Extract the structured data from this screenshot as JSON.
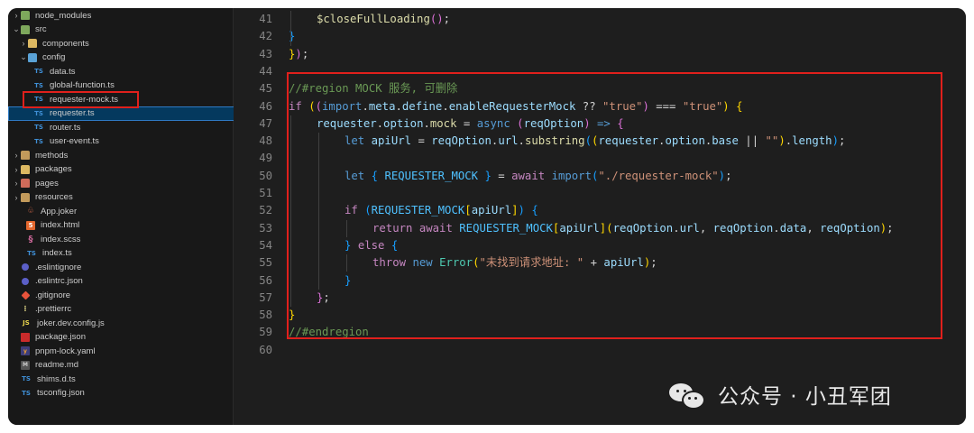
{
  "sidebar": {
    "items": [
      {
        "label": "node_modules",
        "kind": "folder-green",
        "chevron": "›"
      },
      {
        "label": "src",
        "kind": "folder-green",
        "chevron": "⌄"
      },
      {
        "label": "components",
        "kind": "folder",
        "chevron": "›"
      },
      {
        "label": "config",
        "kind": "folder-blue",
        "chevron": "⌄"
      },
      {
        "label": "data.ts",
        "kind": "ts",
        "icon": "TS"
      },
      {
        "label": "global-function.ts",
        "kind": "ts",
        "icon": "TS"
      },
      {
        "label": "requester-mock.ts",
        "kind": "ts",
        "icon": "TS"
      },
      {
        "label": "requester.ts",
        "kind": "ts",
        "icon": "TS"
      },
      {
        "label": "router.ts",
        "kind": "ts",
        "icon": "TS"
      },
      {
        "label": "user-event.ts",
        "kind": "ts",
        "icon": "TS"
      },
      {
        "label": "methods",
        "kind": "folder-brown",
        "chevron": "›"
      },
      {
        "label": "packages",
        "kind": "folder",
        "chevron": "›"
      },
      {
        "label": "pages",
        "kind": "folder-red",
        "chevron": "›"
      },
      {
        "label": "resources",
        "kind": "folder-brown",
        "chevron": "›"
      },
      {
        "label": "App.joker",
        "kind": "joker",
        "icon": "♧"
      },
      {
        "label": "index.html",
        "kind": "html",
        "icon": "5"
      },
      {
        "label": "index.scss",
        "kind": "scss",
        "icon": "§"
      },
      {
        "label": "index.ts",
        "kind": "ts",
        "icon": "TS"
      },
      {
        "label": ".eslintignore",
        "kind": "dot-blue",
        "icon": ""
      },
      {
        "label": ".eslintrc.json",
        "kind": "dot-blue",
        "icon": ""
      },
      {
        "label": ".gitignore",
        "kind": "git",
        "icon": ""
      },
      {
        "label": ".prettierrc",
        "kind": "prettier",
        "icon": "⁝"
      },
      {
        "label": "joker.dev.config.js",
        "kind": "js",
        "icon": "JS"
      },
      {
        "label": "package.json",
        "kind": "npm",
        "icon": ""
      },
      {
        "label": "pnpm-lock.yaml",
        "kind": "yaml",
        "icon": "y"
      },
      {
        "label": "readme.md",
        "kind": "md",
        "icon": "M"
      },
      {
        "label": "shims.d.ts",
        "kind": "ts",
        "icon": "TS"
      },
      {
        "label": "tsconfig.json",
        "kind": "ts",
        "icon": "TS"
      }
    ]
  },
  "editor": {
    "lines": [
      {
        "n": "41",
        "tokens": [
          [
            "c-fn",
            "$closeFullLoading"
          ],
          [
            "c-br2",
            "("
          ],
          [
            "c-br2",
            ")"
          ],
          [
            "c-pl",
            ";"
          ]
        ]
      },
      {
        "n": "42",
        "tokens": [
          [
            "c-br3",
            "}"
          ]
        ]
      },
      {
        "n": "43",
        "tokens": [
          [
            "c-br1",
            "}"
          ],
          [
            "c-br2",
            ")"
          ],
          [
            "c-pl",
            ";"
          ]
        ]
      },
      {
        "n": "44",
        "tokens": []
      },
      {
        "n": "45",
        "tokens": [
          [
            "c-cm",
            "//#region MOCK 服务, 可删除"
          ]
        ]
      },
      {
        "n": "46",
        "tokens": [
          [
            "c-ctl",
            "if"
          ],
          [
            "c-pl",
            " "
          ],
          [
            "c-br1",
            "("
          ],
          [
            "c-br2",
            "("
          ],
          [
            "c-kw",
            "import"
          ],
          [
            "c-pl",
            "."
          ],
          [
            "c-var",
            "meta"
          ],
          [
            "c-pl",
            "."
          ],
          [
            "c-var",
            "define"
          ],
          [
            "c-pl",
            "."
          ],
          [
            "c-var",
            "enableRequesterMock"
          ],
          [
            "c-pl",
            " ?? "
          ],
          [
            "c-str",
            "\"true\""
          ],
          [
            "c-br2",
            ")"
          ],
          [
            "c-pl",
            " === "
          ],
          [
            "c-str",
            "\"true\""
          ],
          [
            "c-br1",
            ")"
          ],
          [
            "c-pl",
            " "
          ],
          [
            "c-br1",
            "{"
          ]
        ]
      },
      {
        "n": "47",
        "tokens": [
          [
            "c-var",
            "requester"
          ],
          [
            "c-pl",
            "."
          ],
          [
            "c-var",
            "option"
          ],
          [
            "c-pl",
            "."
          ],
          [
            "c-fn",
            "mock"
          ],
          [
            "c-pl",
            " = "
          ],
          [
            "c-kw",
            "async"
          ],
          [
            "c-pl",
            " "
          ],
          [
            "c-br2",
            "("
          ],
          [
            "c-var",
            "reqOption"
          ],
          [
            "c-br2",
            ")"
          ],
          [
            "c-pl",
            " "
          ],
          [
            "c-kw",
            "=>"
          ],
          [
            "c-pl",
            " "
          ],
          [
            "c-br2",
            "{"
          ]
        ]
      },
      {
        "n": "48",
        "tokens": [
          [
            "c-kw",
            "let"
          ],
          [
            "c-pl",
            " "
          ],
          [
            "c-var",
            "apiUrl"
          ],
          [
            "c-pl",
            " = "
          ],
          [
            "c-var",
            "reqOption"
          ],
          [
            "c-pl",
            "."
          ],
          [
            "c-var",
            "url"
          ],
          [
            "c-pl",
            "."
          ],
          [
            "c-fn",
            "substring"
          ],
          [
            "c-br3",
            "("
          ],
          [
            "c-br1",
            "("
          ],
          [
            "c-var",
            "requester"
          ],
          [
            "c-pl",
            "."
          ],
          [
            "c-var",
            "option"
          ],
          [
            "c-pl",
            "."
          ],
          [
            "c-var",
            "base"
          ],
          [
            "c-pl",
            " || "
          ],
          [
            "c-str",
            "\"\""
          ],
          [
            "c-br1",
            ")"
          ],
          [
            "c-pl",
            "."
          ],
          [
            "c-var",
            "length"
          ],
          [
            "c-br3",
            ")"
          ],
          [
            "c-pl",
            ";"
          ]
        ]
      },
      {
        "n": "49",
        "tokens": []
      },
      {
        "n": "50",
        "tokens": [
          [
            "c-kw",
            "let"
          ],
          [
            "c-pl",
            " "
          ],
          [
            "c-br3",
            "{"
          ],
          [
            "c-pl",
            " "
          ],
          [
            "c-con",
            "REQUESTER_MOCK"
          ],
          [
            "c-pl",
            " "
          ],
          [
            "c-br3",
            "}"
          ],
          [
            "c-pl",
            " = "
          ],
          [
            "c-ctl",
            "await"
          ],
          [
            "c-pl",
            " "
          ],
          [
            "c-kw",
            "import"
          ],
          [
            "c-br3",
            "("
          ],
          [
            "c-str",
            "\"./requester-mock\""
          ],
          [
            "c-br3",
            ")"
          ],
          [
            "c-pl",
            ";"
          ]
        ]
      },
      {
        "n": "51",
        "tokens": []
      },
      {
        "n": "52",
        "tokens": [
          [
            "c-ctl",
            "if"
          ],
          [
            "c-pl",
            " "
          ],
          [
            "c-br3",
            "("
          ],
          [
            "c-con",
            "REQUESTER_MOCK"
          ],
          [
            "c-br1",
            "["
          ],
          [
            "c-var",
            "apiUrl"
          ],
          [
            "c-br1",
            "]"
          ],
          [
            "c-br3",
            ")"
          ],
          [
            "c-pl",
            " "
          ],
          [
            "c-br3",
            "{"
          ]
        ]
      },
      {
        "n": "53",
        "tokens": [
          [
            "c-ctl",
            "return"
          ],
          [
            "c-pl",
            " "
          ],
          [
            "c-ctl",
            "await"
          ],
          [
            "c-pl",
            " "
          ],
          [
            "c-con",
            "REQUESTER_MOCK"
          ],
          [
            "c-br1",
            "["
          ],
          [
            "c-var",
            "apiUrl"
          ],
          [
            "c-br1",
            "]"
          ],
          [
            "c-br1",
            "("
          ],
          [
            "c-var",
            "reqOption"
          ],
          [
            "c-pl",
            "."
          ],
          [
            "c-var",
            "url"
          ],
          [
            "c-pl",
            ", "
          ],
          [
            "c-var",
            "reqOption"
          ],
          [
            "c-pl",
            "."
          ],
          [
            "c-var",
            "data"
          ],
          [
            "c-pl",
            ", "
          ],
          [
            "c-var",
            "reqOption"
          ],
          [
            "c-br1",
            ")"
          ],
          [
            "c-pl",
            ";"
          ]
        ]
      },
      {
        "n": "54",
        "tokens": [
          [
            "c-br3",
            "}"
          ],
          [
            "c-pl",
            " "
          ],
          [
            "c-ctl",
            "else"
          ],
          [
            "c-pl",
            " "
          ],
          [
            "c-br3",
            "{"
          ]
        ]
      },
      {
        "n": "55",
        "tokens": [
          [
            "c-ctl",
            "throw"
          ],
          [
            "c-pl",
            " "
          ],
          [
            "c-kw",
            "new"
          ],
          [
            "c-pl",
            " "
          ],
          [
            "c-cls",
            "Error"
          ],
          [
            "c-br1",
            "("
          ],
          [
            "c-str",
            "\"未找到请求地址: \""
          ],
          [
            "c-pl",
            " + "
          ],
          [
            "c-var",
            "apiUrl"
          ],
          [
            "c-br1",
            ")"
          ],
          [
            "c-pl",
            ";"
          ]
        ]
      },
      {
        "n": "56",
        "tokens": [
          [
            "c-br3",
            "}"
          ]
        ]
      },
      {
        "n": "57",
        "tokens": [
          [
            "c-br2",
            "}"
          ],
          [
            "c-pl",
            ";"
          ]
        ]
      },
      {
        "n": "58",
        "tokens": [
          [
            "c-br1",
            "}"
          ]
        ]
      },
      {
        "n": "59",
        "tokens": [
          [
            "c-cm",
            "//#endregion"
          ]
        ]
      },
      {
        "n": "60",
        "tokens": []
      }
    ]
  },
  "watermark": {
    "text": "公众号 · 小丑军团",
    "icon": "wechat-icon"
  },
  "colors": {
    "highlight": "#e0201c",
    "selection": "#04395e"
  }
}
